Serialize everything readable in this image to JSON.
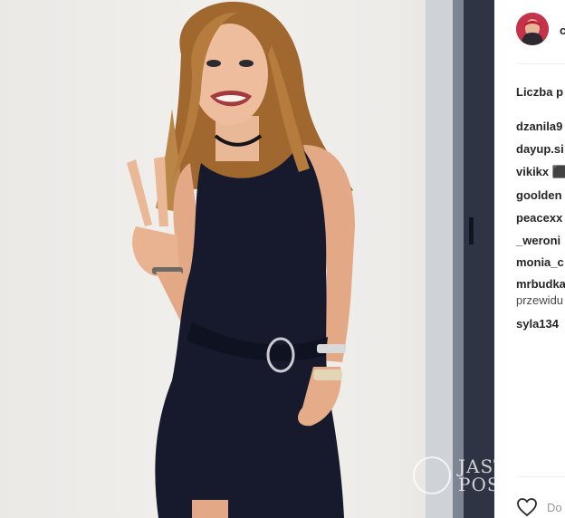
{
  "post": {
    "username": "c",
    "likes_label": "Liczba p",
    "watermark": {
      "line1": "JAST",
      "line2": "POS"
    }
  },
  "comments": [
    {
      "user": "dzanila9"
    },
    {
      "user": "dayup.si"
    },
    {
      "user": "vikikx ⬛"
    },
    {
      "user": "goolden"
    },
    {
      "user": "peacexx"
    },
    {
      "user": "_weroni"
    },
    {
      "user": "monia_c"
    },
    {
      "user": "mrbudka",
      "text": "przewidu"
    },
    {
      "user": "syla134"
    }
  ],
  "footer": {
    "add_comment_placeholder": "Do"
  },
  "icons": {
    "like": "heart-outline-icon"
  },
  "colors": {
    "dress": "#161a2c",
    "hair": "#a26a34",
    "wall": "#eeece9",
    "text": "#262626"
  }
}
